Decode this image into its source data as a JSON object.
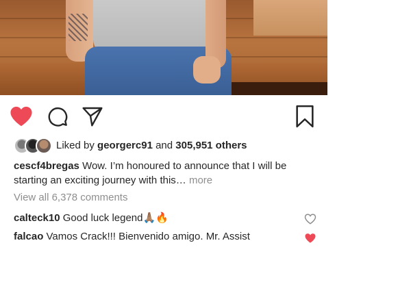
{
  "post": {
    "liked_by": {
      "prefix": "Liked by",
      "user": "georgerc91",
      "joiner": "and",
      "others": "305,951 others"
    },
    "caption": {
      "username": "cescf4bregas",
      "text": "Wow. I’m honoured to announce that I will be starting an exciting journey with this…",
      "more_label": "more"
    },
    "view_all_comments": "View all 6,378 comments",
    "comments": [
      {
        "username": "calteck10",
        "text": "Good luck legend🙏🏽🔥",
        "liked": false
      },
      {
        "username": "falcao",
        "text": "Vamos Crack!!! Bienvenido amigo. Mr. Assist",
        "liked": true
      }
    ]
  },
  "icons": {
    "like": "heart-icon-filled",
    "comment": "comment-icon",
    "share": "share-icon",
    "save": "bookmark-icon"
  },
  "colors": {
    "like_red": "#ed4956",
    "muted_text": "#8e8e8e",
    "text": "#262626"
  }
}
